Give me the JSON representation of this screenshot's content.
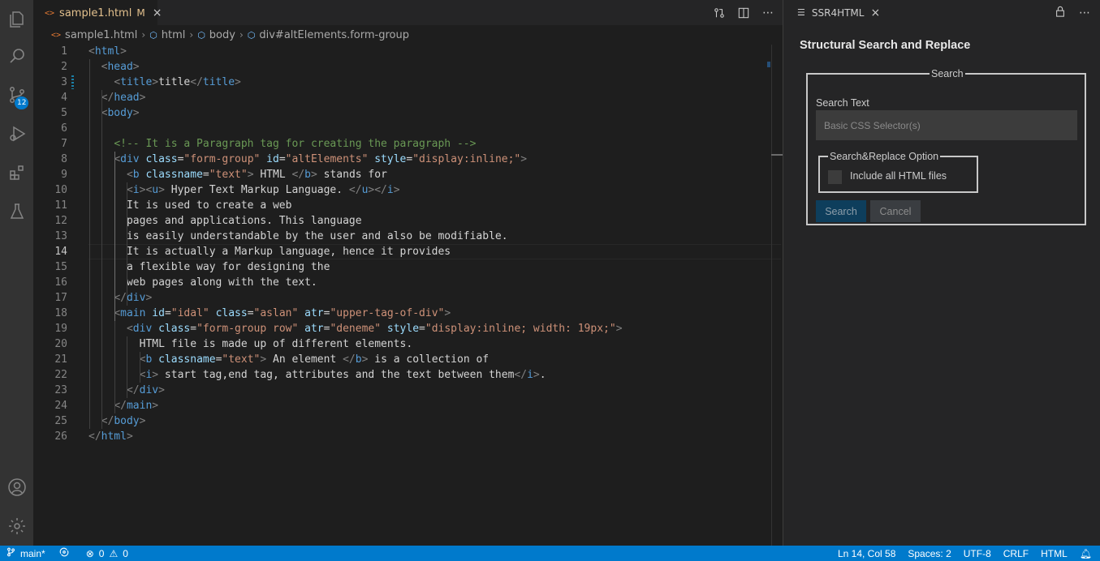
{
  "activity_bar": {
    "items": [
      "explorer-icon",
      "search-icon",
      "source-control-icon",
      "run-debug-icon",
      "extensions-icon",
      "testing-icon"
    ],
    "scm_badge": "12",
    "bottom": [
      "account-icon",
      "manage-gear-icon"
    ]
  },
  "editor": {
    "tab": {
      "icon": "<>",
      "filename": "sample1.html",
      "modified": "M",
      "close": "×"
    },
    "breadcrumb": [
      "sample1.html",
      "html",
      "body",
      "div#altElements.form-group"
    ],
    "cursor_line": 14,
    "lines": [
      [
        [
          "t-br",
          "<"
        ],
        [
          "t-tag",
          "html"
        ],
        [
          "t-br",
          ">"
        ]
      ],
      [
        [
          "t-txt",
          "  "
        ],
        [
          "t-br",
          "<"
        ],
        [
          "t-tag",
          "head"
        ],
        [
          "t-br",
          ">"
        ]
      ],
      [
        [
          "t-txt",
          "    "
        ],
        [
          "t-br",
          "<"
        ],
        [
          "t-tag",
          "title"
        ],
        [
          "t-br",
          ">"
        ],
        [
          "t-txt",
          "title"
        ],
        [
          "t-br",
          "</"
        ],
        [
          "t-tag",
          "title"
        ],
        [
          "t-br",
          ">"
        ]
      ],
      [
        [
          "t-txt",
          "  "
        ],
        [
          "t-br",
          "</"
        ],
        [
          "t-tag",
          "head"
        ],
        [
          "t-br",
          ">"
        ]
      ],
      [
        [
          "t-txt",
          "  "
        ],
        [
          "t-br",
          "<"
        ],
        [
          "t-tag",
          "body"
        ],
        [
          "t-br",
          ">"
        ]
      ],
      [],
      [
        [
          "t-txt",
          "    "
        ],
        [
          "t-com",
          "<!-- It is a Paragraph tag for creating the paragraph -->"
        ]
      ],
      [
        [
          "t-txt",
          "    "
        ],
        [
          "t-br",
          "<"
        ],
        [
          "t-tag",
          "div"
        ],
        [
          "t-txt",
          " "
        ],
        [
          "t-attr",
          "class"
        ],
        [
          "t-txt",
          "="
        ],
        [
          "t-val",
          "\"form-group\""
        ],
        [
          "t-txt",
          " "
        ],
        [
          "t-attr",
          "id"
        ],
        [
          "t-txt",
          "="
        ],
        [
          "t-val",
          "\"altElements\""
        ],
        [
          "t-txt",
          " "
        ],
        [
          "t-attr",
          "style"
        ],
        [
          "t-txt",
          "="
        ],
        [
          "t-val",
          "\"display:inline;\""
        ],
        [
          "t-br",
          ">"
        ]
      ],
      [
        [
          "t-txt",
          "      "
        ],
        [
          "t-br",
          "<"
        ],
        [
          "t-tag",
          "b"
        ],
        [
          "t-txt",
          " "
        ],
        [
          "t-attr",
          "classname"
        ],
        [
          "t-txt",
          "="
        ],
        [
          "t-val",
          "\"text\""
        ],
        [
          "t-br",
          ">"
        ],
        [
          "t-txt",
          " HTML "
        ],
        [
          "t-br",
          "</"
        ],
        [
          "t-tag",
          "b"
        ],
        [
          "t-br",
          ">"
        ],
        [
          "t-txt",
          " stands for"
        ]
      ],
      [
        [
          "t-txt",
          "      "
        ],
        [
          "t-br",
          "<"
        ],
        [
          "t-tag",
          "i"
        ],
        [
          "t-br",
          "><"
        ],
        [
          "t-tag",
          "u"
        ],
        [
          "t-br",
          ">"
        ],
        [
          "t-txt",
          " Hyper Text Markup Language. "
        ],
        [
          "t-br",
          "</"
        ],
        [
          "t-tag",
          "u"
        ],
        [
          "t-br",
          "></"
        ],
        [
          "t-tag",
          "i"
        ],
        [
          "t-br",
          ">"
        ]
      ],
      [
        [
          "t-txt",
          "      It is used to create a web"
        ]
      ],
      [
        [
          "t-txt",
          "      pages and applications. This language"
        ]
      ],
      [
        [
          "t-txt",
          "      is easily understandable by the user and also be modifiable."
        ]
      ],
      [
        [
          "t-txt",
          "      It is actually a Markup language, hence it provides"
        ]
      ],
      [
        [
          "t-txt",
          "      a flexible way for designing the"
        ]
      ],
      [
        [
          "t-txt",
          "      web pages along with the text."
        ]
      ],
      [
        [
          "t-txt",
          "    "
        ],
        [
          "t-br",
          "</"
        ],
        [
          "t-tag",
          "div"
        ],
        [
          "t-br",
          ">"
        ]
      ],
      [
        [
          "t-txt",
          "    "
        ],
        [
          "t-br",
          "<"
        ],
        [
          "t-tag",
          "main"
        ],
        [
          "t-txt",
          " "
        ],
        [
          "t-attr",
          "id"
        ],
        [
          "t-txt",
          "="
        ],
        [
          "t-val",
          "\"idal\""
        ],
        [
          "t-txt",
          " "
        ],
        [
          "t-attr",
          "class"
        ],
        [
          "t-txt",
          "="
        ],
        [
          "t-val",
          "\"aslan\""
        ],
        [
          "t-txt",
          " "
        ],
        [
          "t-attr",
          "atr"
        ],
        [
          "t-txt",
          "="
        ],
        [
          "t-val",
          "\"upper-tag-of-div\""
        ],
        [
          "t-br",
          ">"
        ]
      ],
      [
        [
          "t-txt",
          "      "
        ],
        [
          "t-br",
          "<"
        ],
        [
          "t-tag",
          "div"
        ],
        [
          "t-txt",
          " "
        ],
        [
          "t-attr",
          "class"
        ],
        [
          "t-txt",
          "="
        ],
        [
          "t-val",
          "\"form-group row\""
        ],
        [
          "t-txt",
          " "
        ],
        [
          "t-attr",
          "atr"
        ],
        [
          "t-txt",
          "="
        ],
        [
          "t-val",
          "\"deneme\""
        ],
        [
          "t-txt",
          " "
        ],
        [
          "t-attr",
          "style"
        ],
        [
          "t-txt",
          "="
        ],
        [
          "t-val",
          "\"display:inline; width: 19px;\""
        ],
        [
          "t-br",
          ">"
        ]
      ],
      [
        [
          "t-txt",
          "        HTML file is made up of different elements."
        ]
      ],
      [
        [
          "t-txt",
          "        "
        ],
        [
          "t-br",
          "<"
        ],
        [
          "t-tag",
          "b"
        ],
        [
          "t-txt",
          " "
        ],
        [
          "t-attr",
          "classname"
        ],
        [
          "t-txt",
          "="
        ],
        [
          "t-val",
          "\"text\""
        ],
        [
          "t-br",
          ">"
        ],
        [
          "t-txt",
          " An element "
        ],
        [
          "t-br",
          "</"
        ],
        [
          "t-tag",
          "b"
        ],
        [
          "t-br",
          ">"
        ],
        [
          "t-txt",
          " is a collection of"
        ]
      ],
      [
        [
          "t-txt",
          "        "
        ],
        [
          "t-br",
          "<"
        ],
        [
          "t-tag",
          "i"
        ],
        [
          "t-br",
          ">"
        ],
        [
          "t-txt",
          " start tag,end tag, attributes and the text between them"
        ],
        [
          "t-br",
          "</"
        ],
        [
          "t-tag",
          "i"
        ],
        [
          "t-br",
          ">"
        ],
        [
          "t-txt",
          "."
        ]
      ],
      [
        [
          "t-txt",
          "      "
        ],
        [
          "t-br",
          "</"
        ],
        [
          "t-tag",
          "div"
        ],
        [
          "t-br",
          ">"
        ]
      ],
      [
        [
          "t-txt",
          "    "
        ],
        [
          "t-br",
          "</"
        ],
        [
          "t-tag",
          "main"
        ],
        [
          "t-br",
          ">"
        ]
      ],
      [
        [
          "t-txt",
          "  "
        ],
        [
          "t-br",
          "</"
        ],
        [
          "t-tag",
          "body"
        ],
        [
          "t-br",
          ">"
        ]
      ],
      [
        [
          "t-br",
          "</"
        ],
        [
          "t-tag",
          "html"
        ],
        [
          "t-br",
          ">"
        ]
      ]
    ]
  },
  "panel": {
    "tab_title": "SSR4HTML",
    "tab_close": "×",
    "heading": "Structural Search and Replace",
    "search_legend": "Search",
    "search_text_label": "Search Text",
    "search_placeholder": "Basic CSS Selector(s)",
    "option_legend": "Search&Replace Option",
    "include_all_label": "Include all HTML files",
    "search_button": "Search",
    "cancel_button": "Cancel"
  },
  "status_bar": {
    "branch": "main*",
    "errors": "0",
    "warnings": "0",
    "position": "Ln 14, Col 58",
    "spaces": "Spaces: 2",
    "encoding": "UTF-8",
    "eol": "CRLF",
    "language": "HTML"
  },
  "colors": {
    "accent": "#007acc",
    "activity_bar": "#333333",
    "editor_bg": "#1e1e1e",
    "side_bg": "#252526"
  }
}
